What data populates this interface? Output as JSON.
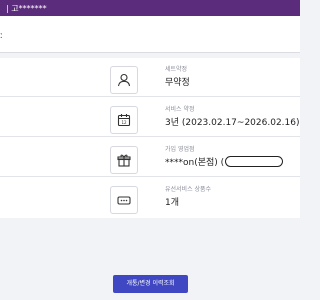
{
  "header": {
    "title": "| 고*******"
  },
  "subheader": {
    "link_text": "ː"
  },
  "info_rows": [
    {
      "icon": "person-icon",
      "label": "세트약정",
      "value": "무약정"
    },
    {
      "icon": "calendar-icon",
      "label": "서비스 약정",
      "value": "3년 (2023.02.17~2026.02.16)"
    },
    {
      "icon": "gift-icon",
      "label": "가입 영업점",
      "value": "****on(본점) ("
    },
    {
      "icon": "device-icon",
      "label": "유선서비스 상품수",
      "value": "1개"
    }
  ],
  "actions": {
    "history_button": "개통/변경 이력조회"
  }
}
